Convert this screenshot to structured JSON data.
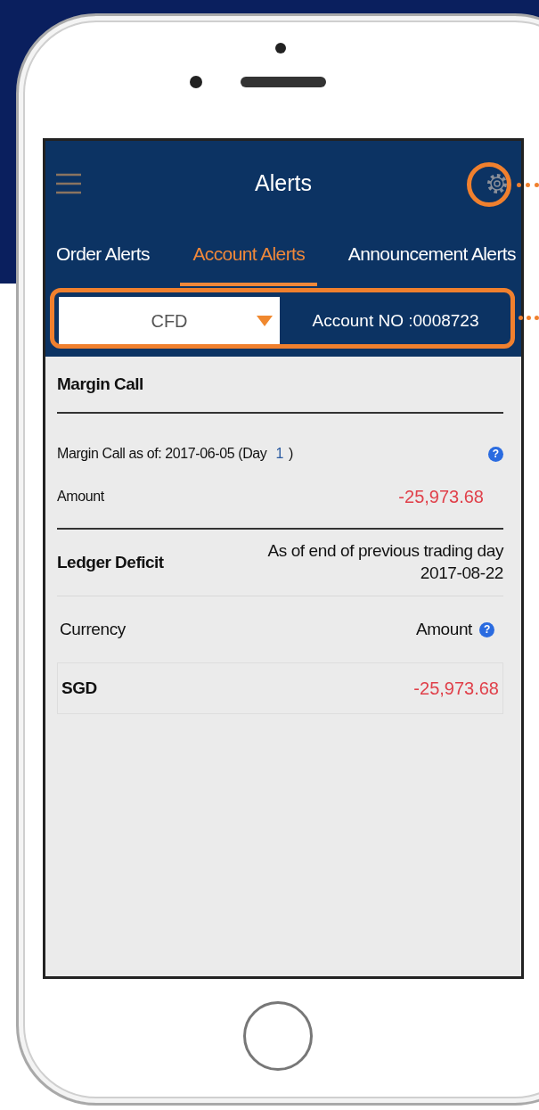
{
  "header": {
    "title": "Alerts"
  },
  "tabs": [
    {
      "label": "Order Alerts",
      "selected": false
    },
    {
      "label": "Account Alerts",
      "selected": true
    },
    {
      "label": "Announcement Alerts",
      "selected": false
    }
  ],
  "account_selector": {
    "product": "CFD",
    "account": "Account NO :0008723"
  },
  "margin_call": {
    "title": "Margin Call",
    "as_of": "Margin Call as of: 2017-06-05 (Day",
    "day": "1",
    "as_of_end": ")",
    "help": "?",
    "amount_label": "Amount",
    "amount": "-25,973.68"
  },
  "ledger_deficit": {
    "title": "Ledger Deficit",
    "note": "As of end of previous trading day",
    "date": "2017-08-22",
    "columns": [
      {
        "label": "Currency"
      },
      {
        "label": "Amount",
        "help": "?"
      }
    ],
    "rows": [
      {
        "currency": "SGD",
        "amount": "-25,973.68"
      }
    ]
  }
}
